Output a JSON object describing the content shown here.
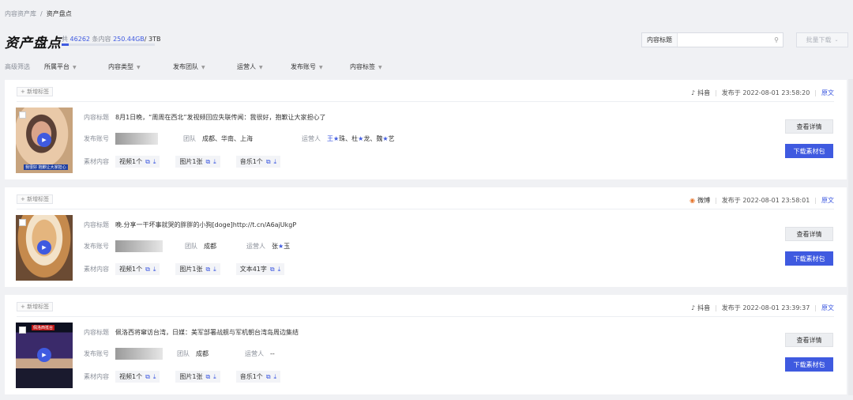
{
  "breadcrumb": {
    "parent": "内容资产库",
    "sep": "/",
    "current": "资产盘点"
  },
  "title": "资产盘点",
  "stats": {
    "prefix": "共",
    "count": "46262",
    "unit": "条内容",
    "used": "250.44GB",
    "total": "/ 3TB",
    "progress": 0.08
  },
  "search": {
    "label": "内容标题",
    "value": "",
    "placeholder": ""
  },
  "bulk_download": "批量下载",
  "filters": {
    "label": "高级筛选",
    "items": [
      "所属平台",
      "内容类型",
      "发布团队",
      "运营人",
      "发布账号",
      "内容标签"
    ]
  },
  "labels": {
    "add_tag": "+ 新增标签",
    "title_key": "内容标题",
    "account_key": "发布账号",
    "team_key": "团队",
    "operator_key": "运营人",
    "material_key": "素材内容",
    "published_at": "发布于",
    "original": "原文",
    "view_detail": "查看详情",
    "download_pkg": "下载素材包"
  },
  "cards": [
    {
      "platform": "抖音",
      "time": "2022-08-01 23:58:20",
      "content_title": "8月1日晚，“周周在西北”发视频回应失联传闻：我很好，抱歉让大家担心了",
      "team": "成都、华南、上海",
      "operator": {
        "a": "王",
        "b": "珠、杜",
        "c": "龙、魏",
        "d": "艺"
      },
      "materials": [
        "视频1个",
        "图片1张",
        "音乐1个"
      ],
      "thumb_caption": "我很好 抱歉让大家担心"
    },
    {
      "platform": "微博",
      "time": "2022-08-01 23:58:01",
      "content_title": "晚.分享一干坏事就哭的胖胖的小狗[doge]http://t.cn/A6ajUkgP",
      "team": "成都",
      "operator": {
        "a": "张",
        "b": "玉",
        "c": "",
        "d": ""
      },
      "materials": [
        "视频1个",
        "图片1张",
        "文本41字"
      ],
      "thumb_caption": ""
    },
    {
      "platform": "抖音",
      "time": "2022-08-01 23:39:37",
      "content_title": "佩洛西将窜访台湾，日媒：美军部署战舰与军机朝台湾岛周边集结",
      "team": "成都",
      "operator": {
        "a": "--",
        "b": "",
        "c": "",
        "d": ""
      },
      "materials": [
        "视频1个",
        "图片1张",
        "音乐1个"
      ],
      "thumb_caption": "佩洛西抵台"
    }
  ],
  "colors": {
    "accent": "#3f5ae0",
    "page_bg": "#f0f1f4"
  }
}
